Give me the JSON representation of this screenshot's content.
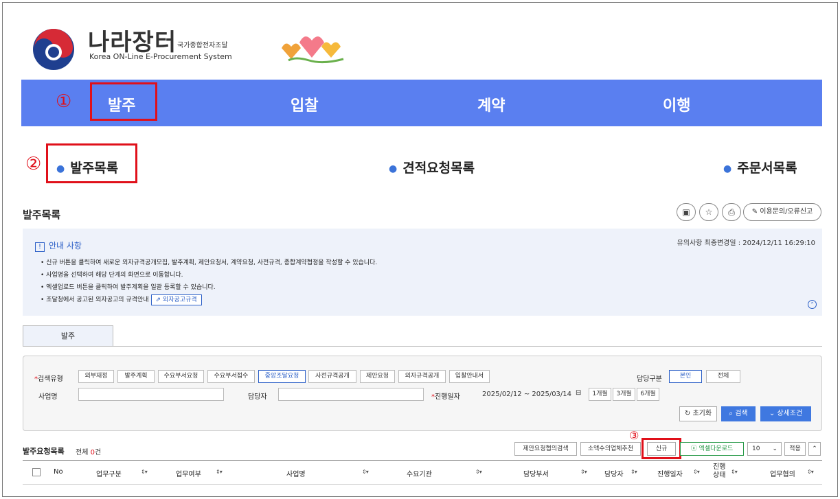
{
  "header": {
    "logo_kr": "나라장터",
    "logo_kr_small": "국가종합전자조달",
    "logo_en": "Korea ON-Line E-Procurement System"
  },
  "nav": {
    "items": [
      "발주",
      "입찰",
      "계약",
      "이행"
    ],
    "markers": [
      "①",
      "②",
      "③"
    ]
  },
  "subnav": {
    "items": [
      "발주목록",
      "견적요청목록",
      "주문서목록"
    ]
  },
  "page_title": "발주목록",
  "toolbar": {
    "inquiry_label": "이용문의/오류신고"
  },
  "notice": {
    "title": "안내 사항",
    "updated": "유의사항 최종변경일 : 2024/12/11 16:29:10",
    "lines": [
      "• 신규 버튼을 클릭하여 새로운 외자규격공개모집, 발주계획, 제안요청서, 계약요청, 사전규격, 종합계약협정을 작성할 수 있습니다.",
      "• 사업명을 선택하여 해당 단계의 화면으로 이동합니다.",
      "• 엑셀업로드 버튼을 클릭하여 발주계획을 일괄 등록할 수 있습니다.",
      "• 조달청에서 공고된 외자공고의 규격안내"
    ],
    "link_label": "외자공고규격"
  },
  "tab": {
    "label": "발주"
  },
  "search": {
    "type_label": "검색유형",
    "type_options": [
      "외부재정",
      "발주계획",
      "수요부서요청",
      "수요부서접수",
      "중앙조달요청",
      "사전규격공개",
      "제안요청",
      "외자규격공개",
      "입찰안내서"
    ],
    "selected_type": "중앙조달요청",
    "owner_label": "담당구분",
    "owner_options": [
      "본인",
      "전체"
    ],
    "project_label": "사업명",
    "manager_label": "담당자",
    "progress_date_label": "진행일자",
    "date_range": "2025/02/12 ~ 2025/03/14",
    "period_options": [
      "1개월",
      "3개월",
      "6개월"
    ],
    "reset_label": "초기화",
    "search_label": "검색",
    "detail_label": "상세조건"
  },
  "list": {
    "title": "발주요청목록",
    "count_prefix": "전체 ",
    "count": "0",
    "count_suffix": "건",
    "buttons": {
      "proposal_search": "제안요청협의검색",
      "small_recommend": "소액수의업체추천",
      "new": "신규",
      "excel": "엑셀다운로드",
      "page_size": "10",
      "apply": "적용"
    },
    "columns": [
      "No",
      "업무구분",
      "업무여부",
      "사업명",
      "수요기관",
      "담당부서",
      "담당자",
      "진행일자",
      "진행\n상태",
      "업무협의"
    ]
  }
}
